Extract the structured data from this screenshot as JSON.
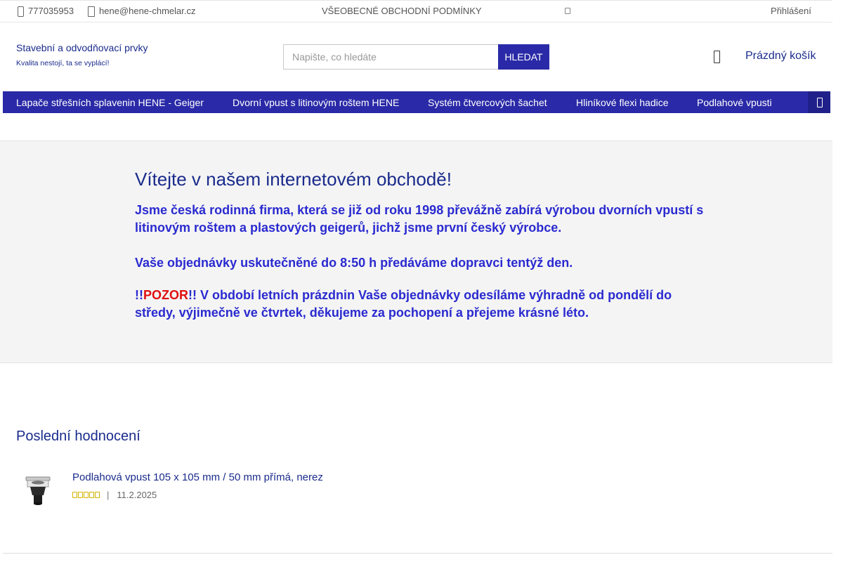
{
  "topbar": {
    "phone": "777035953",
    "email": "hene@hene-chmelar.cz",
    "terms": "VŠEOBECNÉ OBCHODNÍ PODMÍNKY",
    "login": "Přihlášení"
  },
  "brand": {
    "title": "Stavební a odvodňovací prvky",
    "subtitle": "Kvalita nestojí, ta se vyplácí!"
  },
  "search": {
    "placeholder": "Napište, co hledáte",
    "button_label": "Hledat"
  },
  "cart": {
    "label": "Prázdný košík"
  },
  "nav": {
    "items": [
      "Lapače střešních splavenin HENE - Geiger",
      "Dvorní vpust s litinovým roštem HENE",
      "Systém čtvercových šachet",
      "Hliníkové flexi hadice",
      "Podlahové vpusti"
    ]
  },
  "welcome": {
    "heading": "Vítejte v našem internetovém obchodě!",
    "p1": "Jsme česká rodinná firma, která se již od roku 1998 převážně zabírá výrobou dvorních vpustí s litinovým roštem a plastových geigerů, jichž jsme první český výrobce.",
    "p2": "Vaše objednávky uskutečněné do 8:50 h předáváme dopravci tentýž den.",
    "p3_prefix": "!!",
    "p3_warning": "POZOR",
    "p3_rest": "!! V období letních prázdnin Vaše objednávky odesíláme výhradně od pondělí do středy, výjimečně ve čtvrtek, děkujeme za pochopení a přejeme krásné léto."
  },
  "reviews": {
    "title": "Poslední hodnocení",
    "items": [
      {
        "product": "Podlahová vpust 105 x 105 mm / 50 mm přímá, nerez",
        "rating": 5,
        "separator": "|",
        "date": "11.2.2025"
      }
    ]
  },
  "colors": {
    "brand_blue": "#2a2aa8",
    "text_blue": "#1a2b8c",
    "highlight_blue": "#2a2ad0",
    "warning_red": "#e01010",
    "star_gold": "#d4b200"
  }
}
